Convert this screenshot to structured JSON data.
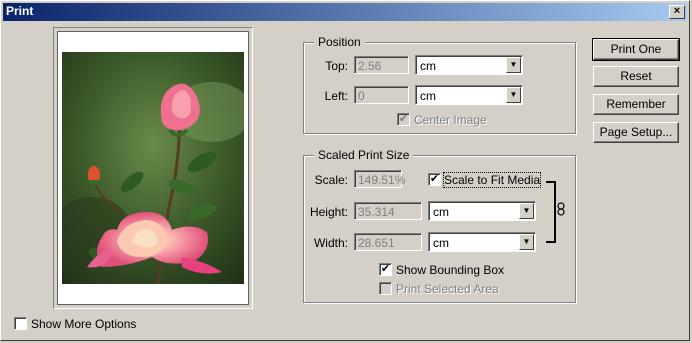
{
  "window": {
    "title": "Print",
    "close_label": "×"
  },
  "position": {
    "group_label": "Position",
    "top_label": "Top:",
    "top_value": "2.56",
    "top_unit": "cm",
    "left_label": "Left:",
    "left_value": "0",
    "left_unit": "cm",
    "center_image_label": "Center Image",
    "center_image_checked": "✔"
  },
  "scaled": {
    "group_label": "Scaled Print Size",
    "scale_label": "Scale:",
    "scale_value": "149.51%",
    "scale_to_fit_label": "Scale to Fit Media",
    "scale_to_fit_checked": "✔",
    "height_label": "Height:",
    "height_value": "35.314",
    "height_unit": "cm",
    "width_label": "Width:",
    "width_value": "28.651",
    "width_unit": "cm",
    "show_bbox_label": "Show Bounding Box",
    "show_bbox_checked": "✔",
    "print_selected_label": "Print Selected Area"
  },
  "buttons": {
    "print_one": "Print One",
    "reset": "Reset",
    "remember": "Remember",
    "page_setup": "Page Setup..."
  },
  "footer": {
    "show_more_label": "Show More Options"
  },
  "icons": {
    "link": "chain-link-icon",
    "dropdown": "▼"
  }
}
